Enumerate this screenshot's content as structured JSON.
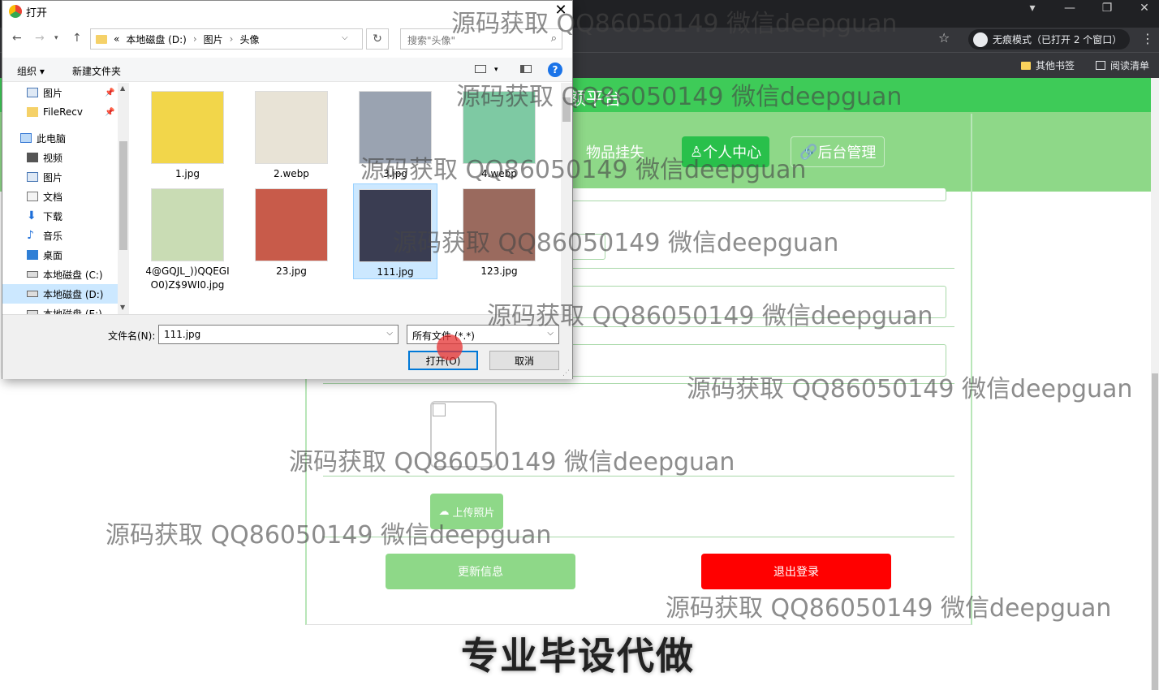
{
  "browser": {
    "incognito_label": "无痕模式（已打开 2 个窗口）",
    "bookmarks": [
      "其他书签",
      "阅读清单"
    ]
  },
  "site": {
    "title_partial": "额平台",
    "nav": [
      "物品挂失",
      "个人中心",
      "后台管理"
    ],
    "upload_label": "上传照片",
    "update_label": "更新信息",
    "logout_label": "退出登录",
    "banner": "专业毕设代做"
  },
  "dialog": {
    "title": "打开",
    "path": [
      "«",
      "本地磁盘 (D:)",
      "图片",
      "头像"
    ],
    "search_placeholder": "搜索\"头像\"",
    "organize": "组织 ▾",
    "new_folder": "新建文件夹",
    "tree": [
      {
        "label": "图片",
        "icon": "pictures-icon"
      },
      {
        "label": "FileRecv",
        "icon": "folder-icon"
      },
      {
        "label": "此电脑",
        "icon": "computer-icon"
      },
      {
        "label": "视频",
        "icon": "video-icon"
      },
      {
        "label": "图片",
        "icon": "pictures-icon"
      },
      {
        "label": "文档",
        "icon": "document-icon"
      },
      {
        "label": "下载",
        "icon": "download-icon"
      },
      {
        "label": "音乐",
        "icon": "music-icon"
      },
      {
        "label": "桌面",
        "icon": "desktop-icon"
      },
      {
        "label": "本地磁盘 (C:)",
        "icon": "drive-icon"
      },
      {
        "label": "本地磁盘 (D:)",
        "icon": "drive-icon"
      },
      {
        "label": "本地磁盘 (E:)",
        "icon": "drive-icon"
      }
    ],
    "files": [
      {
        "name": "1.jpg",
        "color": "#f2d64a"
      },
      {
        "name": "2.webp",
        "color": "#e8e3d6"
      },
      {
        "name": "3.jpg",
        "color": "#9aa3b1"
      },
      {
        "name": "4.webp",
        "color": "#7ec9a3"
      },
      {
        "name": "4@GQJL_))QQEGIO0)Z$9WI0.jpg",
        "color": "#c9dcb4"
      },
      {
        "name": "23.jpg",
        "color": "#c85b4a"
      },
      {
        "name": "111.jpg",
        "color": "#3a3d52"
      },
      {
        "name": "123.jpg",
        "color": "#9a6a5e"
      }
    ],
    "filename_label": "文件名(N):",
    "filename_value": "111.jpg",
    "filetype_value": "所有文件 (*.*)",
    "open_label": "打开(O)",
    "cancel_label": "取消"
  },
  "watermark": "源码获取 QQ86050149 微信deepguan"
}
